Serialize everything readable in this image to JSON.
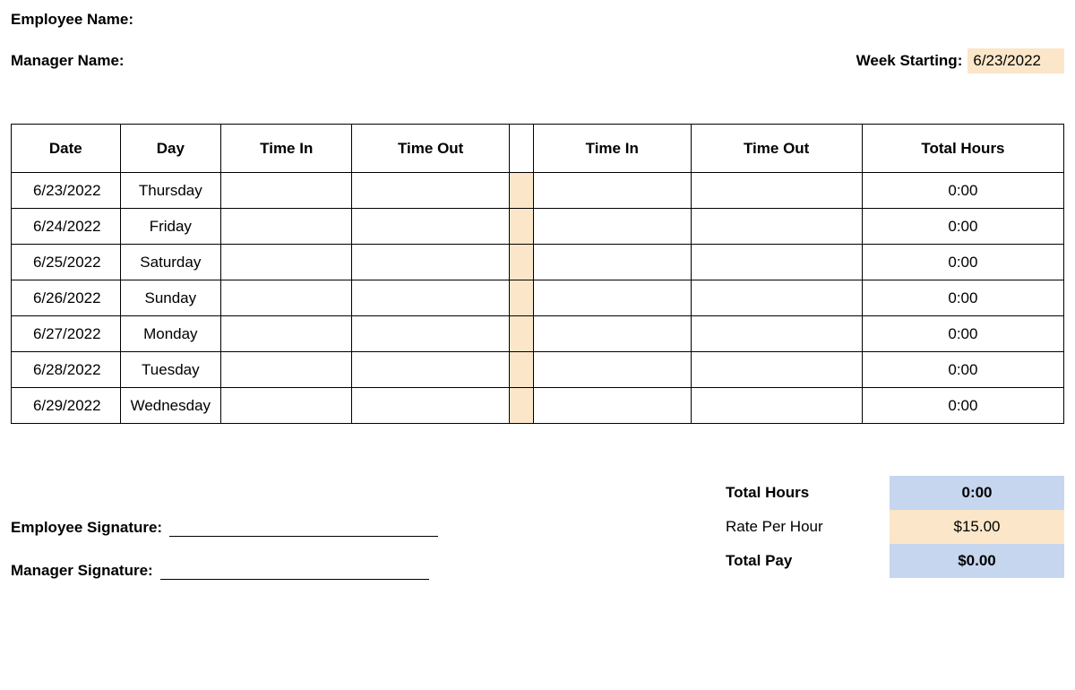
{
  "labels": {
    "employee_name": "Employee Name:",
    "manager_name": "Manager Name:",
    "week_starting": "Week Starting:",
    "employee_signature": "Employee Signature:",
    "manager_signature": "Manager Signature:",
    "total_hours": "Total Hours",
    "rate_per_hour": "Rate Per Hour",
    "total_pay": "Total Pay"
  },
  "header": {
    "employee_name": "",
    "manager_name": "",
    "week_starting": "6/23/2022"
  },
  "columns": {
    "date": "Date",
    "day": "Day",
    "time_in_1": "Time In",
    "time_out_1": "Time Out",
    "time_in_2": "Time In",
    "time_out_2": "Time Out",
    "total_hours": "Total Hours"
  },
  "rows": [
    {
      "date": "6/23/2022",
      "day": "Thursday",
      "time_in_1": "",
      "time_out_1": "",
      "time_in_2": "",
      "time_out_2": "",
      "total_hours": "0:00"
    },
    {
      "date": "6/24/2022",
      "day": "Friday",
      "time_in_1": "",
      "time_out_1": "",
      "time_in_2": "",
      "time_out_2": "",
      "total_hours": "0:00"
    },
    {
      "date": "6/25/2022",
      "day": "Saturday",
      "time_in_1": "",
      "time_out_1": "",
      "time_in_2": "",
      "time_out_2": "",
      "total_hours": "0:00"
    },
    {
      "date": "6/26/2022",
      "day": "Sunday",
      "time_in_1": "",
      "time_out_1": "",
      "time_in_2": "",
      "time_out_2": "",
      "total_hours": "0:00"
    },
    {
      "date": "6/27/2022",
      "day": "Monday",
      "time_in_1": "",
      "time_out_1": "",
      "time_in_2": "",
      "time_out_2": "",
      "total_hours": "0:00"
    },
    {
      "date": "6/28/2022",
      "day": "Tuesday",
      "time_in_1": "",
      "time_out_1": "",
      "time_in_2": "",
      "time_out_2": "",
      "total_hours": "0:00"
    },
    {
      "date": "6/29/2022",
      "day": "Wednesday",
      "time_in_1": "",
      "time_out_1": "",
      "time_in_2": "",
      "time_out_2": "",
      "total_hours": "0:00"
    }
  ],
  "summary": {
    "total_hours": "0:00",
    "rate_per_hour": "$15.00",
    "total_pay": "$0.00"
  },
  "chart_data": {
    "type": "table",
    "title": "Weekly Timesheet",
    "columns": [
      "Date",
      "Day",
      "Time In",
      "Time Out",
      "Time In",
      "Time Out",
      "Total Hours"
    ],
    "rows": [
      [
        "6/23/2022",
        "Thursday",
        "",
        "",
        "",
        "",
        "0:00"
      ],
      [
        "6/24/2022",
        "Friday",
        "",
        "",
        "",
        "",
        "0:00"
      ],
      [
        "6/25/2022",
        "Saturday",
        "",
        "",
        "",
        "",
        "0:00"
      ],
      [
        "6/26/2022",
        "Sunday",
        "",
        "",
        "",
        "",
        "0:00"
      ],
      [
        "6/27/2022",
        "Monday",
        "",
        "",
        "",
        "",
        "0:00"
      ],
      [
        "6/28/2022",
        "Tuesday",
        "",
        "",
        "",
        "",
        "0:00"
      ],
      [
        "6/29/2022",
        "Wednesday",
        "",
        "",
        "",
        "",
        "0:00"
      ]
    ],
    "summary": {
      "Total Hours": "0:00",
      "Rate Per Hour": "$15.00",
      "Total Pay": "$0.00"
    }
  }
}
